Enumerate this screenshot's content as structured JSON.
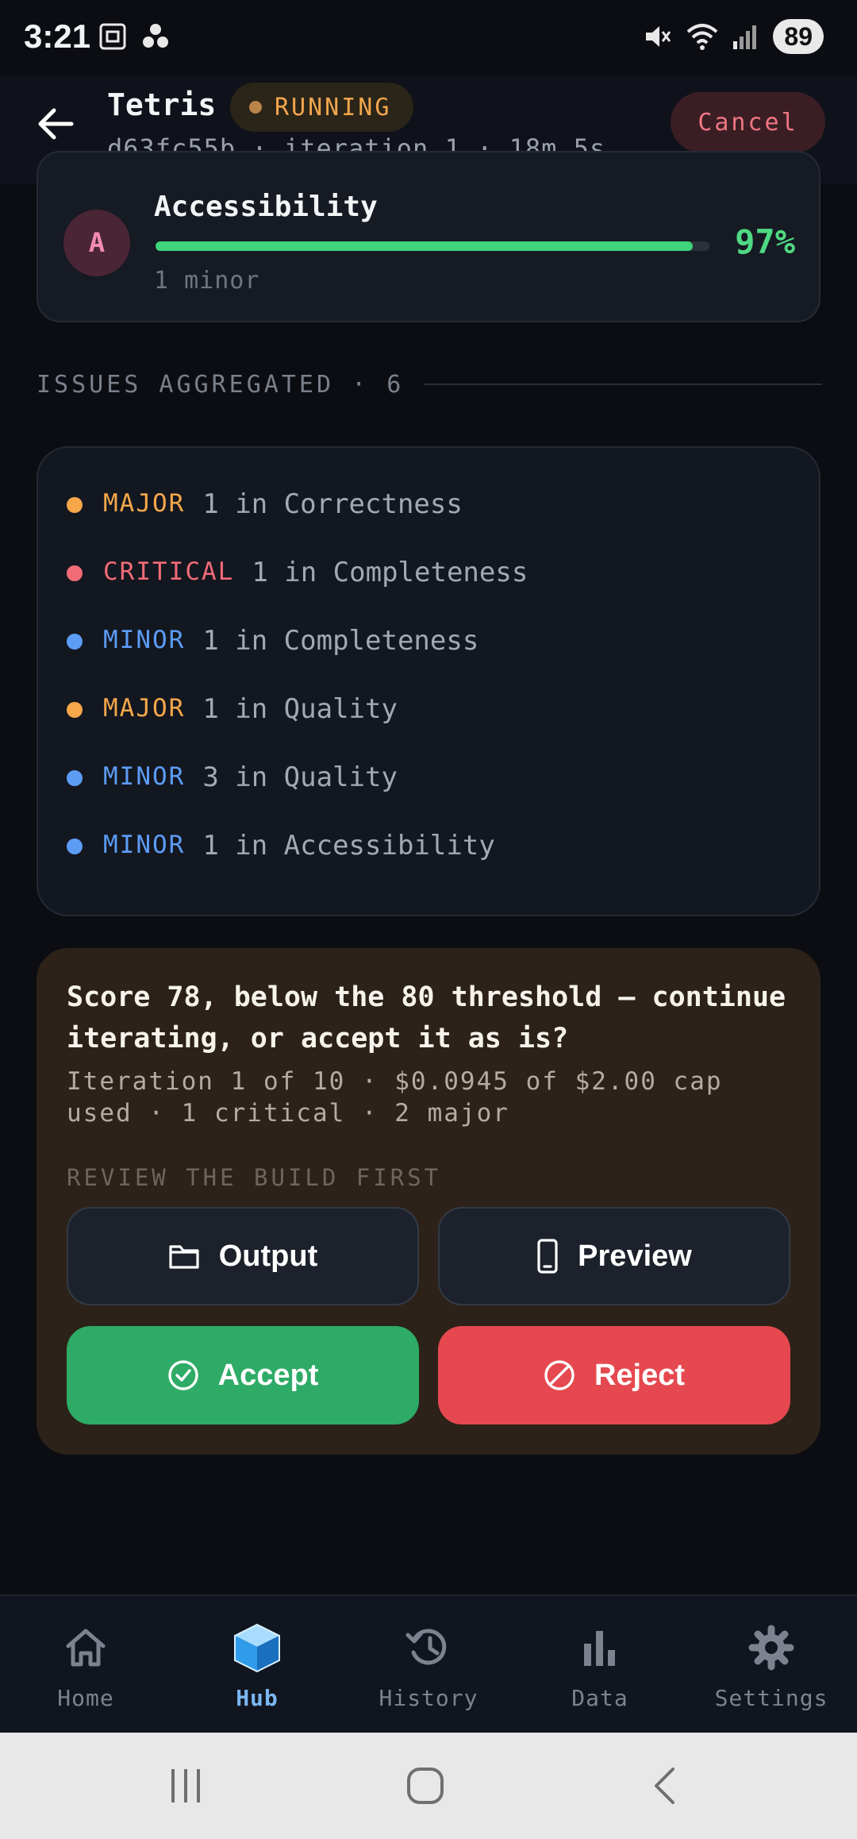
{
  "status_bar": {
    "time": "3:21",
    "battery": "89"
  },
  "header": {
    "title": "Tetris",
    "status": "RUNNING",
    "subtitle": "d63fc55b · iteration 1 · 18m 5s",
    "cancel_label": "Cancel"
  },
  "score_card": {
    "avatar_letter": "A",
    "label": "Accessibility",
    "percent": "97%",
    "progress": 0.97,
    "sub": "1 minor"
  },
  "issues_section": {
    "title": "ISSUES AGGREGATED · 6"
  },
  "issues": [
    {
      "severity": "MAJOR",
      "text": "1 in Correctness",
      "color": "#f5a74a"
    },
    {
      "severity": "CRITICAL",
      "text": "1 in Completeness",
      "color": "#f26b78"
    },
    {
      "severity": "MINOR",
      "text": "1 in Completeness",
      "color": "#5c9cf5"
    },
    {
      "severity": "MAJOR",
      "text": "1 in Quality",
      "color": "#f5a74a"
    },
    {
      "severity": "MINOR",
      "text": "3 in Quality",
      "color": "#5c9cf5"
    },
    {
      "severity": "MINOR",
      "text": "1 in Accessibility",
      "color": "#5c9cf5"
    }
  ],
  "decision": {
    "title": "Score 78, below the 80 threshold — continue iterating, or accept it as is?",
    "meta": "Iteration 1 of 10 · $0.0945 of $2.00 cap used · 1 critical · 2 major",
    "review_label": "REVIEW THE BUILD FIRST",
    "output_label": "Output",
    "preview_label": "Preview",
    "accept_label": "Accept",
    "reject_label": "Reject"
  },
  "bottom_nav": {
    "items": [
      {
        "label": "Home",
        "icon": "home-icon"
      },
      {
        "label": "Hub",
        "icon": "cube-icon",
        "active": true
      },
      {
        "label": "History",
        "icon": "history-icon"
      },
      {
        "label": "Data",
        "icon": "bar-chart-icon"
      },
      {
        "label": "Settings",
        "icon": "gear-icon"
      }
    ]
  }
}
